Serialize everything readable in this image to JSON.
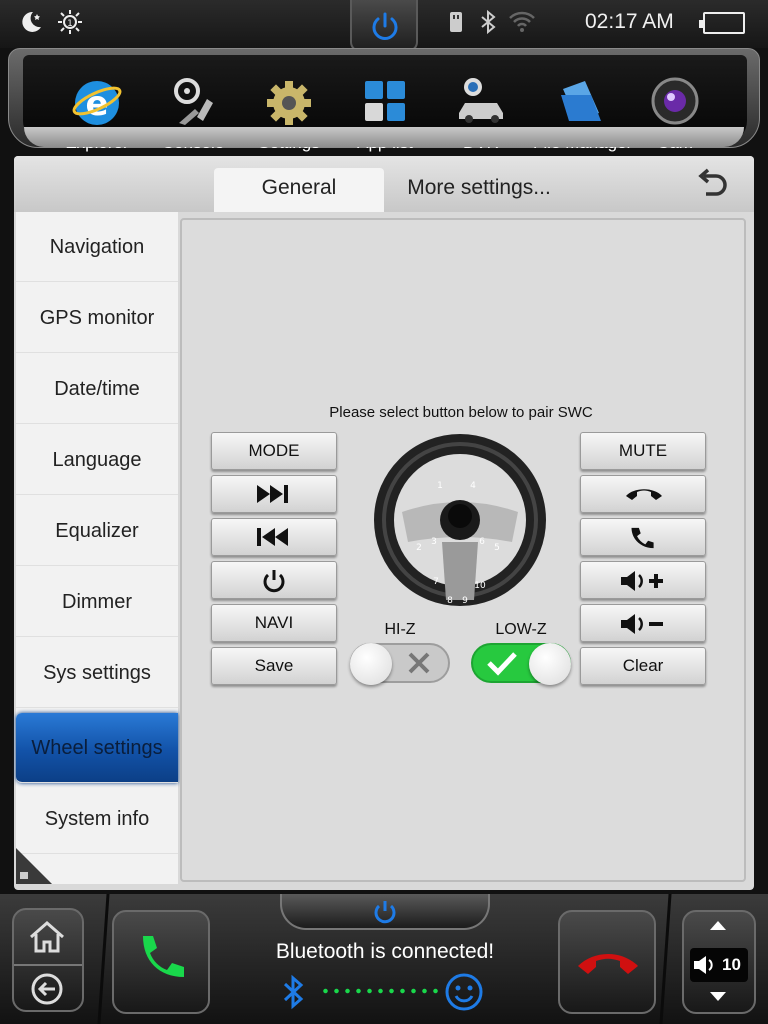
{
  "status_bar": {
    "time": "02:17 AM",
    "icons": [
      "moon-icon",
      "brightness-icon",
      "power-icon",
      "usb-icon",
      "bluetooth-icon",
      "wifi-icon",
      "battery-icon"
    ]
  },
  "dock": {
    "apps": [
      {
        "label": "Explorer",
        "icon": "browser-icon"
      },
      {
        "label": "Console",
        "icon": "steering-console-icon"
      },
      {
        "label": "Settings",
        "icon": "gear-icon"
      },
      {
        "label": "App list",
        "icon": "app-grid-icon"
      },
      {
        "label": "DVR",
        "icon": "dvr-car-icon"
      },
      {
        "label": "File Manager",
        "icon": "folder-icon"
      },
      {
        "label": "Cam",
        "icon": "camera-icon"
      }
    ]
  },
  "tabs": {
    "general": "General",
    "more": "More settings..."
  },
  "sidebar": {
    "items": [
      {
        "label": "Navigation"
      },
      {
        "label": "GPS monitor"
      },
      {
        "label": "Date/time"
      },
      {
        "label": "Language"
      },
      {
        "label": "Equalizer"
      },
      {
        "label": "Dimmer"
      },
      {
        "label": "Sys settings"
      },
      {
        "label": "Wheel settings",
        "active": true
      },
      {
        "label": "System info"
      }
    ]
  },
  "wheel": {
    "instruction": "Please select button below to pair SWC",
    "left_buttons": {
      "mode": "MODE",
      "next": "next-track-icon",
      "prev": "previous-track-icon",
      "power": "power-icon",
      "navi": "NAVI",
      "save": "Save"
    },
    "right_buttons": {
      "mute": "MUTE",
      "hangup": "hang-up-icon",
      "call": "call-icon",
      "vol_up": "volume-up-icon",
      "vol_down": "volume-down-icon",
      "clear": "Clear"
    },
    "wheel_numbers": [
      "1",
      "2",
      "3",
      "4",
      "5",
      "6",
      "7",
      "8",
      "9",
      "10"
    ],
    "hi_z": {
      "label": "HI-Z",
      "on": false
    },
    "low_z": {
      "label": "LOW-Z",
      "on": true
    }
  },
  "bottom_bar": {
    "status": "Bluetooth is connected!",
    "volume": "10",
    "accent_green": "#19d84b",
    "accent_blue": "#1e7be6",
    "hangup_red": "#d01010"
  }
}
